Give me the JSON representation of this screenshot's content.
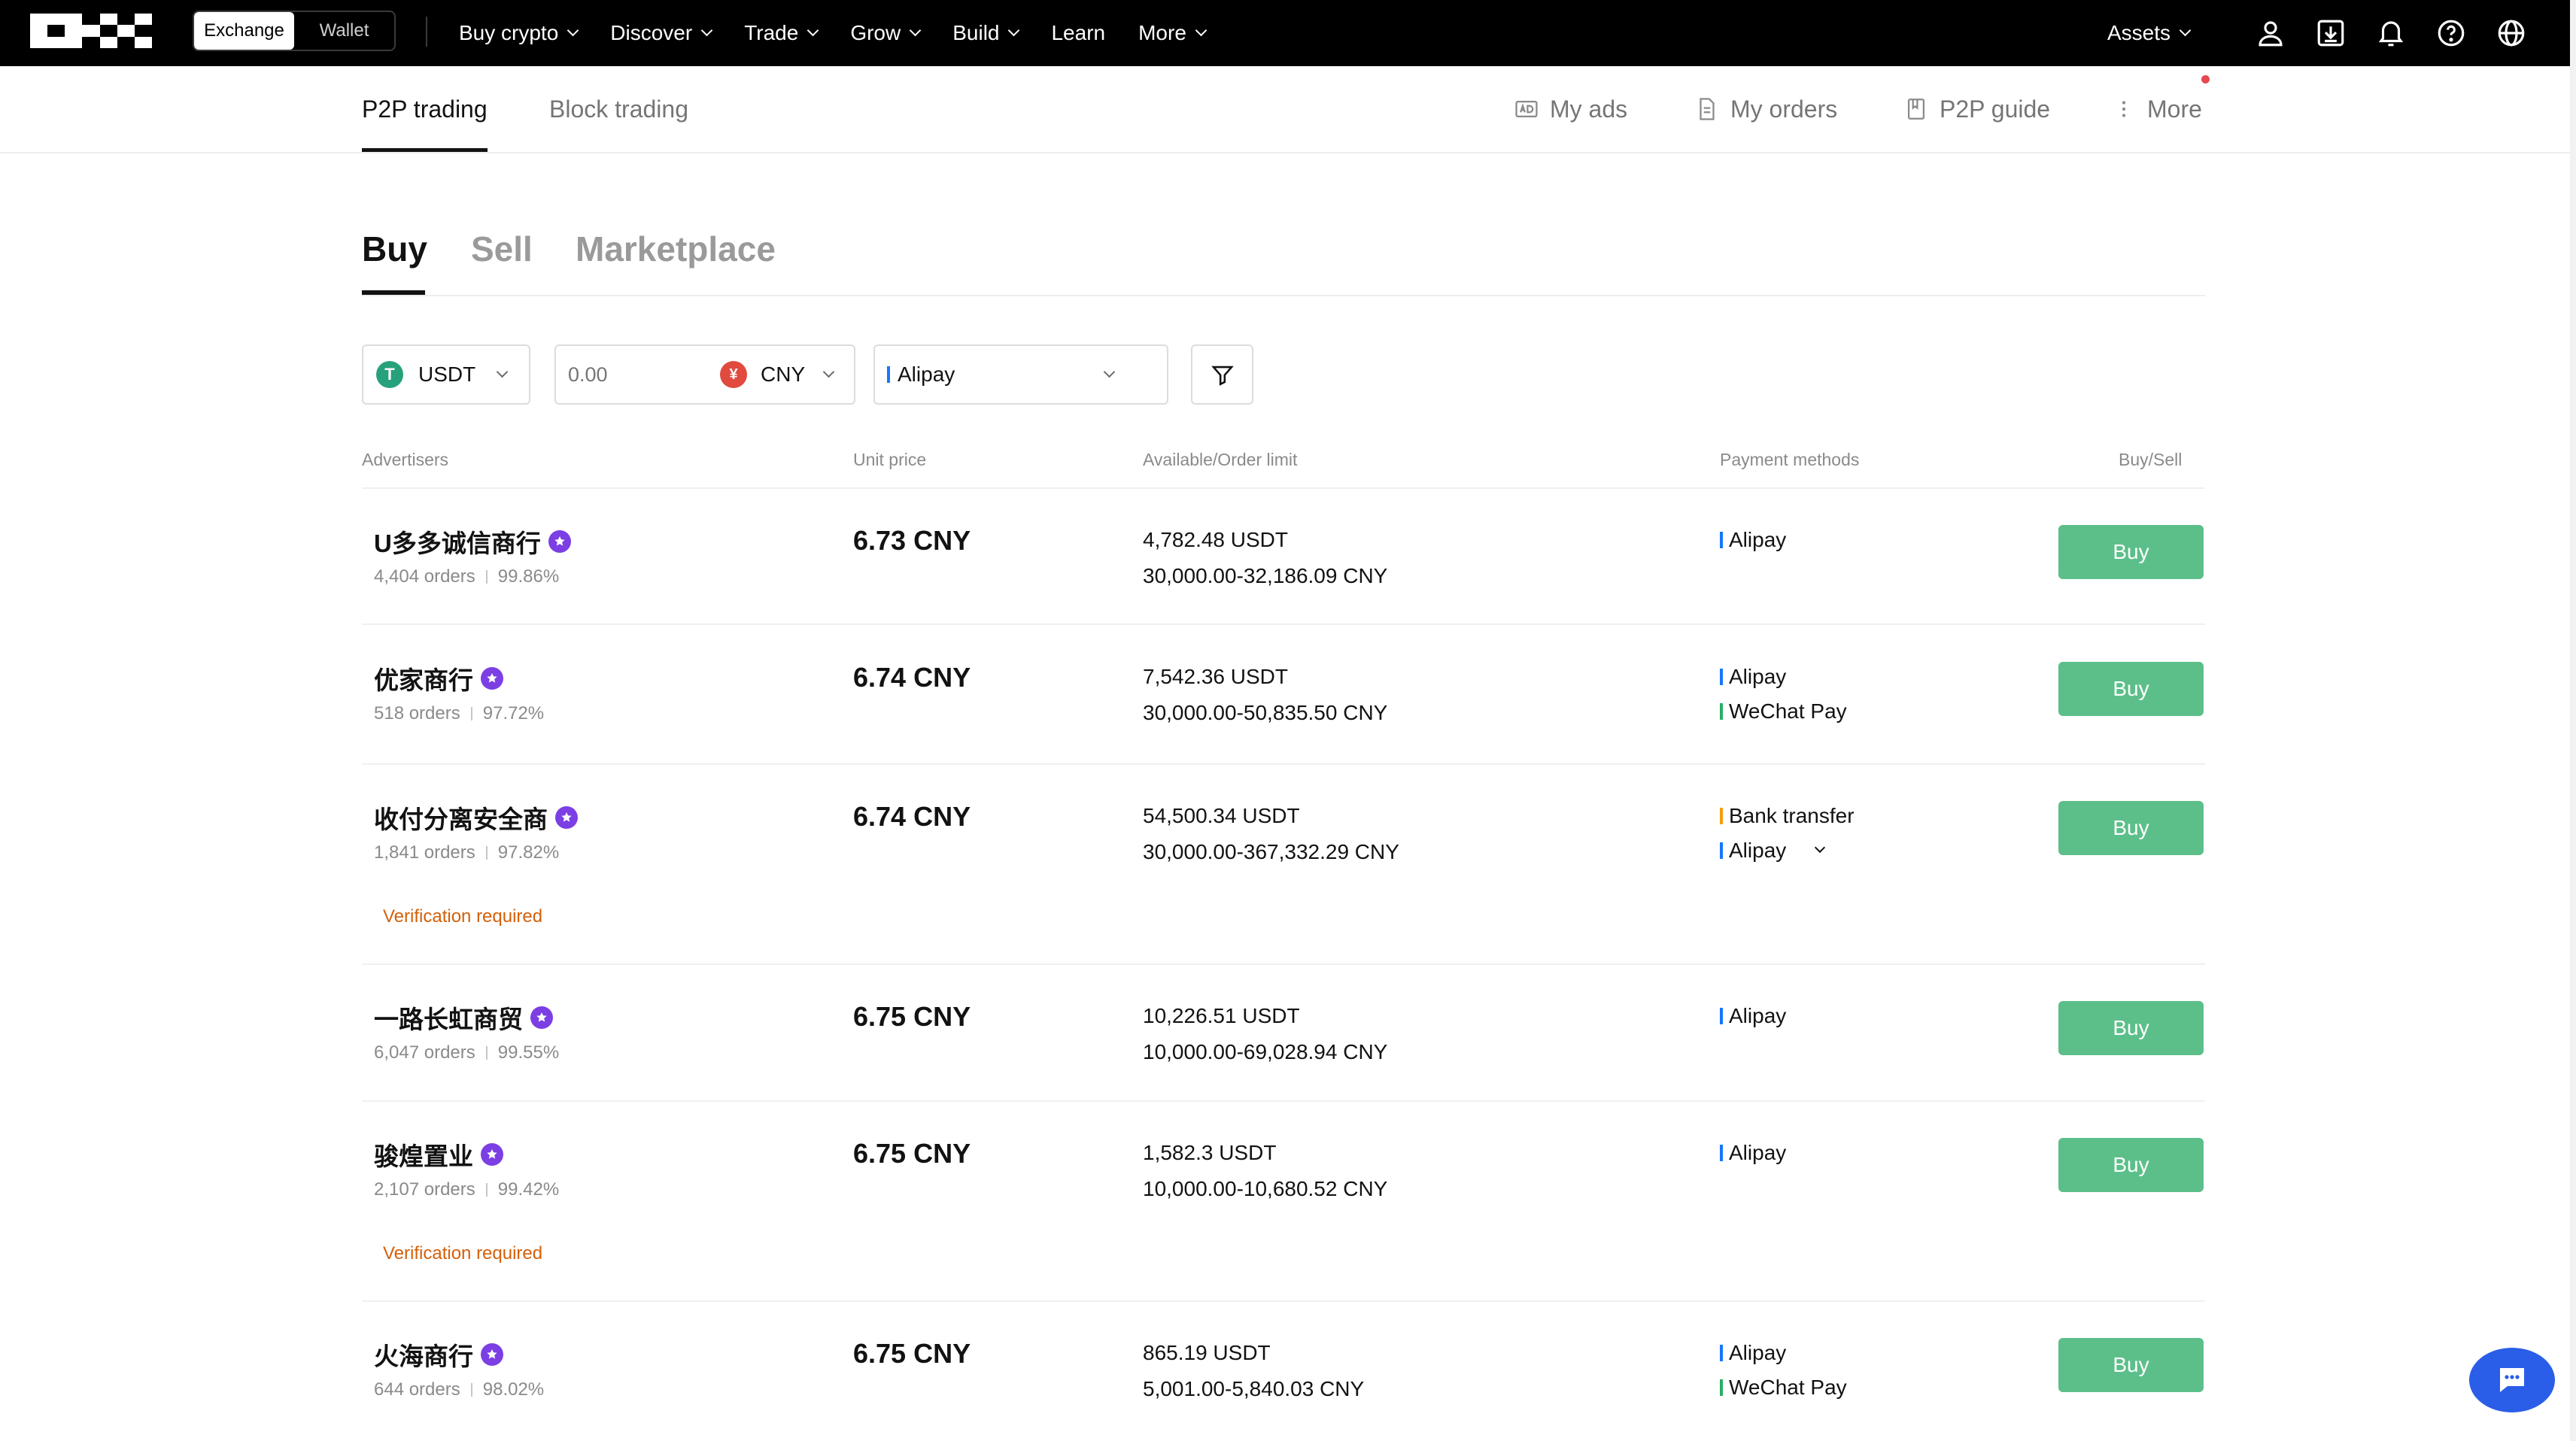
{
  "topnav": {
    "switch": [
      "Exchange",
      "Wallet"
    ],
    "items": [
      {
        "label": "Buy crypto",
        "chevron": true
      },
      {
        "label": "Discover",
        "chevron": true
      },
      {
        "label": "Trade",
        "chevron": true
      },
      {
        "label": "Grow",
        "chevron": true
      },
      {
        "label": "Build",
        "chevron": true
      },
      {
        "label": "Learn",
        "chevron": false
      },
      {
        "label": "More",
        "chevron": true
      }
    ],
    "assets_label": "Assets",
    "icons": [
      "user-icon",
      "download-icon",
      "bell-icon",
      "help-icon",
      "globe-icon"
    ]
  },
  "subnav": {
    "tabs": [
      "P2P trading",
      "Block trading"
    ],
    "right": [
      {
        "label": "My ads",
        "icon": "ad-icon"
      },
      {
        "label": "My orders",
        "icon": "document-icon"
      },
      {
        "label": "P2P guide",
        "icon": "book-icon"
      },
      {
        "label": "More",
        "icon": "kebab-icon"
      }
    ]
  },
  "main": {
    "tabs": [
      "Buy",
      "Sell",
      "Marketplace"
    ]
  },
  "filters": {
    "coin": "USDT",
    "amount_placeholder": "0.00",
    "currency": "CNY",
    "currency_symbol": "¥",
    "payment": "Alipay",
    "coin_symbol": "T"
  },
  "table": {
    "headers": [
      "Advertisers",
      "Unit price",
      "Available/Order limit",
      "Payment methods",
      "Buy/Sell"
    ],
    "rows": [
      {
        "name": "U多多诚信商行",
        "orders": "4,404 orders",
        "rate": "99.86%",
        "verify": "",
        "price": "6.73 CNY",
        "available": "4,782.48 USDT",
        "limit": "30,000.00-32,186.09 CNY",
        "payments": [
          "Alipay"
        ],
        "button": "Buy"
      },
      {
        "name": "优家商行",
        "orders": "518 orders",
        "rate": "97.72%",
        "verify": "",
        "price": "6.74 CNY",
        "available": "7,542.36 USDT",
        "limit": "30,000.00-50,835.50 CNY",
        "payments": [
          "Alipay",
          "WeChat Pay"
        ],
        "button": "Buy"
      },
      {
        "name": "收付分离安全商",
        "orders": "1,841 orders",
        "rate": "97.82%",
        "verify": "Verification required",
        "price": "6.74 CNY",
        "available": "54,500.34 USDT",
        "limit": "30,000.00-367,332.29 CNY",
        "payments": [
          "Bank transfer",
          "Alipay"
        ],
        "button": "Buy"
      },
      {
        "name": "一路长虹商贸",
        "orders": "6,047 orders",
        "rate": "99.55%",
        "verify": "",
        "price": "6.75 CNY",
        "available": "10,226.51 USDT",
        "limit": "10,000.00-69,028.94 CNY",
        "payments": [
          "Alipay"
        ],
        "button": "Buy"
      },
      {
        "name": "骏煌置业",
        "orders": "2,107 orders",
        "rate": "99.42%",
        "verify": "Verification required",
        "price": "6.75 CNY",
        "available": "1,582.3 USDT",
        "limit": "10,000.00-10,680.52 CNY",
        "payments": [
          "Alipay"
        ],
        "button": "Buy"
      },
      {
        "name": "火海商行",
        "orders": "644 orders",
        "rate": "98.02%",
        "verify": "",
        "price": "6.75 CNY",
        "available": "865.19 USDT",
        "limit": "5,001.00-5,840.03 CNY",
        "payments": [
          "Alipay",
          "WeChat Pay"
        ],
        "button": "Buy"
      }
    ]
  },
  "colors": {
    "buy_button": "#5cbf8a",
    "verify_text": "#d3600b",
    "alipay_bar": "#1677ff",
    "wechat_bar": "#2aae67",
    "bank_bar": "#f59e0b",
    "badge": "#7b3fe4",
    "usdt_icon": "#26a17b",
    "cny_icon": "#e04a3f",
    "chat": "#2a5ee8"
  }
}
